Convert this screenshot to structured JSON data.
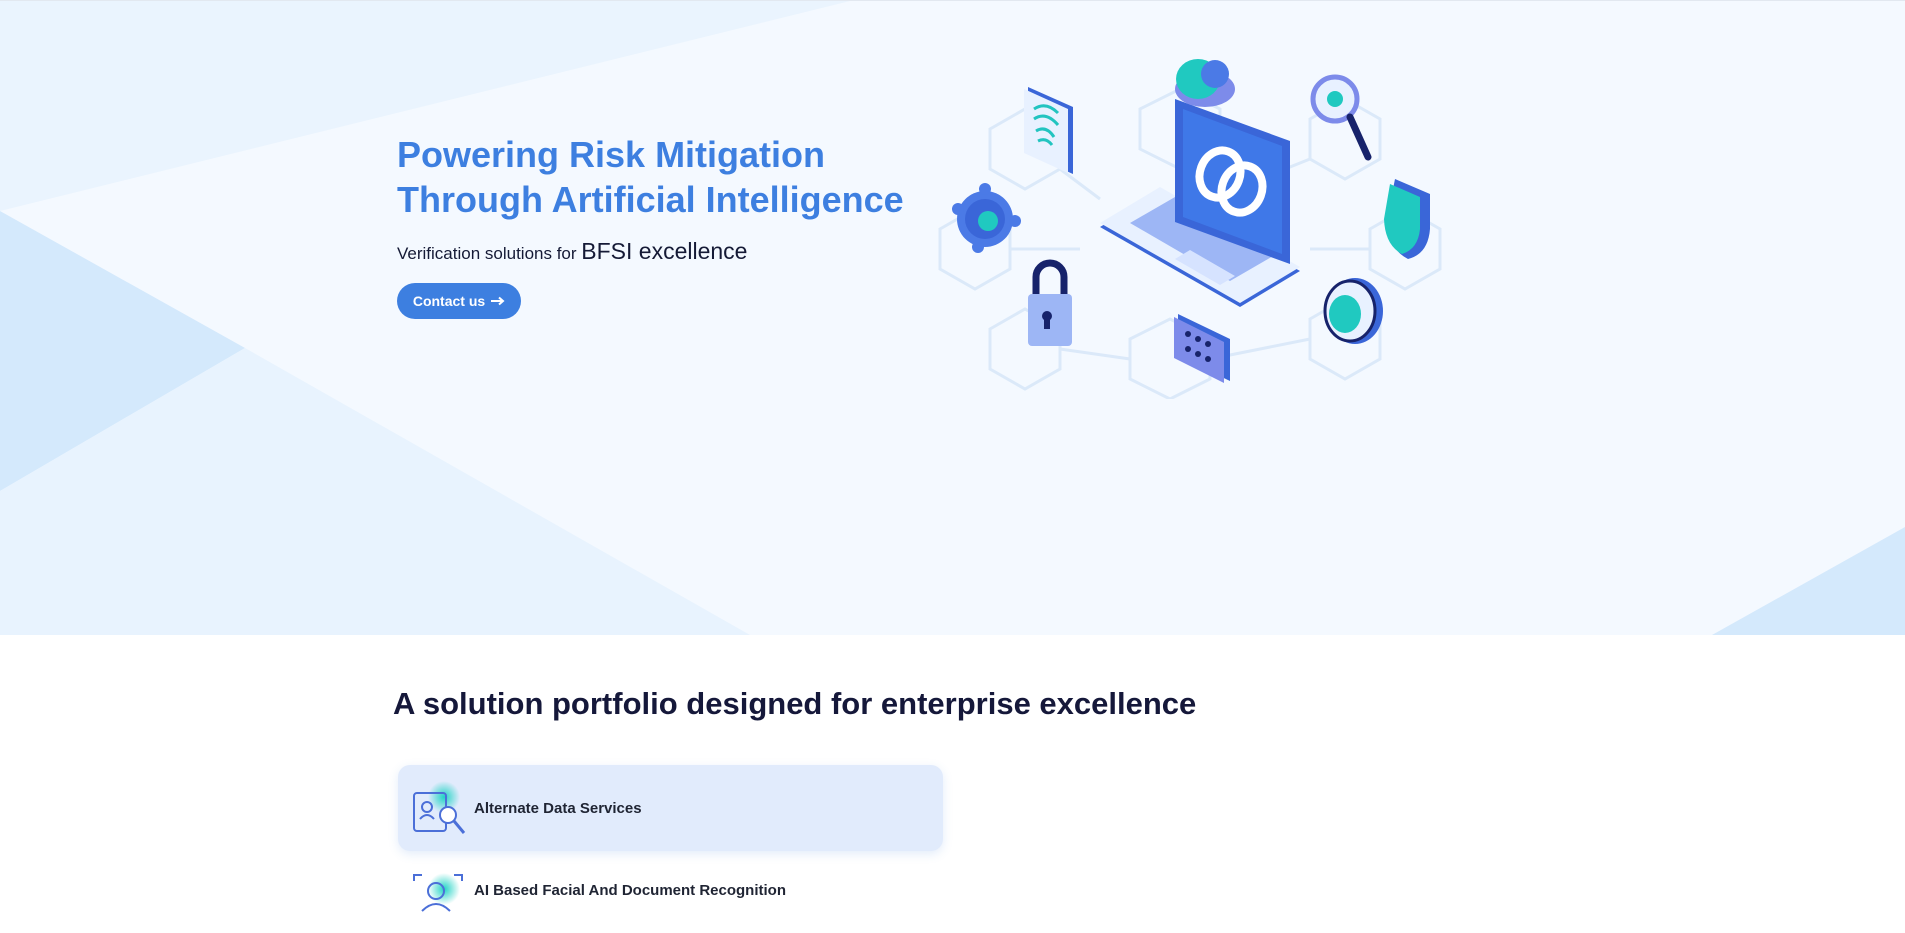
{
  "hero": {
    "title": "Powering Risk Mitigation Through Artificial Intelligence",
    "subtitle_prefix": "Verification solutions for",
    "subtitle_emphasis": "BFSI excellence",
    "cta": {
      "label": "Contact us",
      "icon": "arrow-right-icon"
    },
    "illustration_icons": [
      "laptop-icon",
      "link-icon",
      "cloud-icon",
      "fingerprint-icon",
      "bug-search-icon",
      "gear-icon",
      "shield-icon",
      "padlock-icon",
      "server-icon",
      "vault-dial-icon"
    ]
  },
  "solutions": {
    "title": "A solution portfolio designed for enterprise excellence",
    "items": [
      {
        "label": "Alternate Data Services",
        "icon": "document-search-icon",
        "active": true
      },
      {
        "label": "AI Based Facial And Document Recognition",
        "icon": "face-recognition-icon",
        "active": false
      }
    ]
  },
  "colors": {
    "accent": "#3d7fe0",
    "heading": "#15183a",
    "hero_bg": "#f4f9ff",
    "card_active": "#e1ebfc",
    "teal": "#22d3c5"
  }
}
